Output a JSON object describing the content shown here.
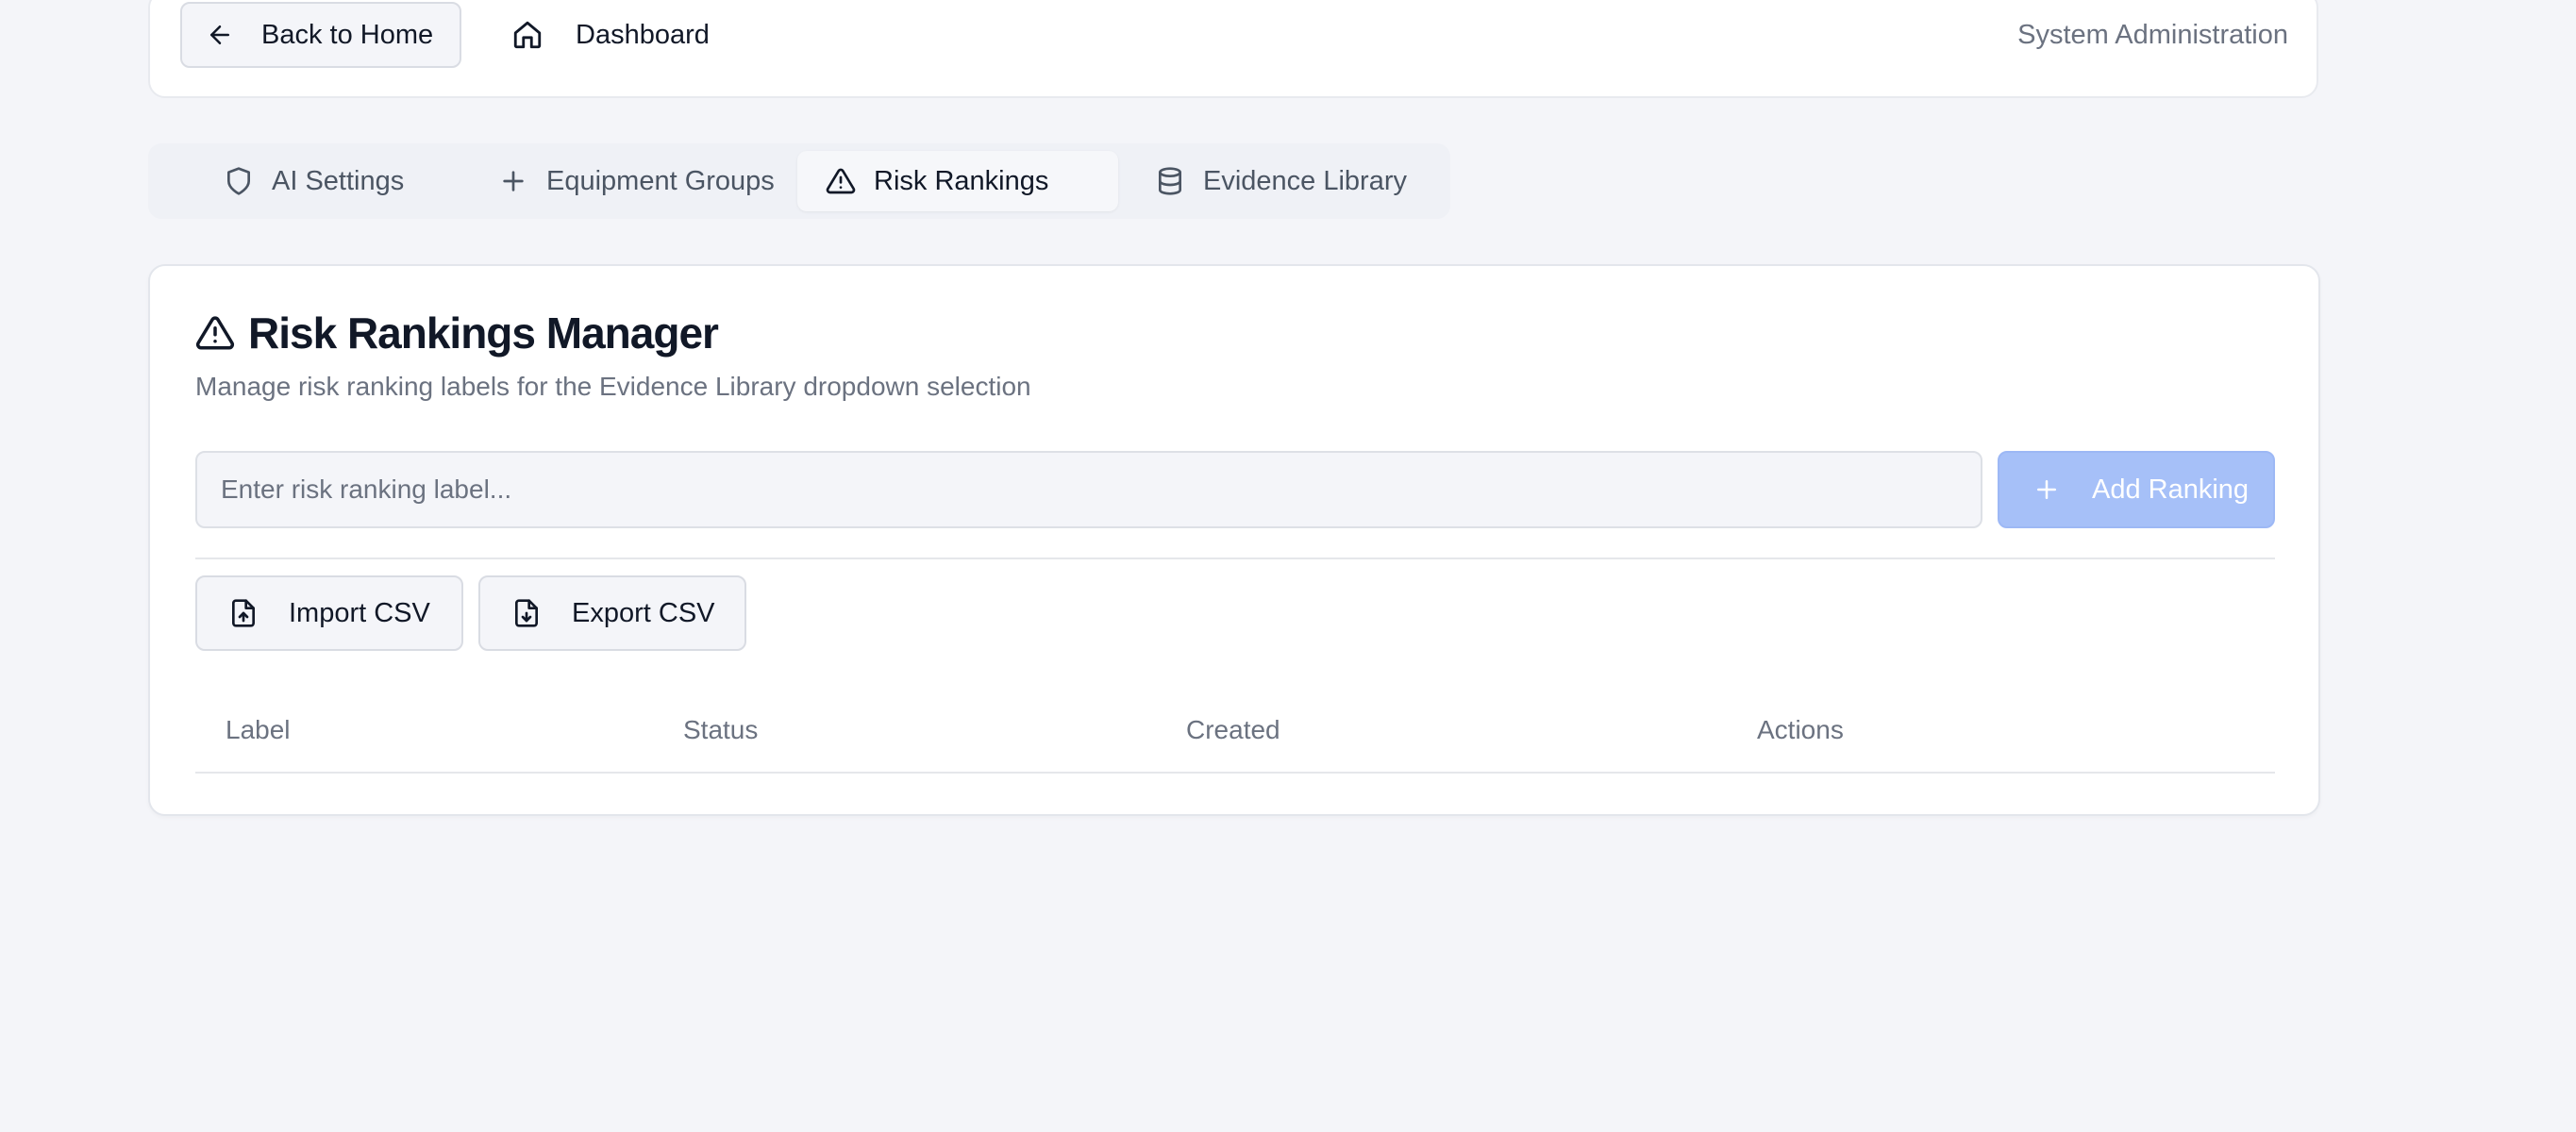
{
  "header": {
    "back_label": "Back to Home",
    "dashboard_label": "Dashboard",
    "right_label": "System Administration"
  },
  "tabs": [
    {
      "label": "AI Settings",
      "icon": "shield-icon",
      "active": false
    },
    {
      "label": "Equipment Groups",
      "icon": "plus-icon",
      "active": false
    },
    {
      "label": "Risk Rankings",
      "icon": "alert-triangle-icon",
      "active": true
    },
    {
      "label": "Evidence Library",
      "icon": "database-icon",
      "active": false
    }
  ],
  "manager": {
    "title": "Risk Rankings Manager",
    "subtitle": "Manage risk ranking labels for the Evidence Library dropdown selection",
    "input_placeholder": "Enter risk ranking label...",
    "input_value": "",
    "add_button_label": "Add Ranking",
    "import_label": "Import CSV",
    "export_label": "Export CSV"
  },
  "table": {
    "columns": [
      "Label",
      "Status",
      "Created",
      "Actions"
    ],
    "rows": []
  },
  "colors": {
    "background": "#f4f5f9",
    "accent_disabled": "#a6c0f8",
    "text_primary": "#111827",
    "text_muted": "#6b7280"
  }
}
